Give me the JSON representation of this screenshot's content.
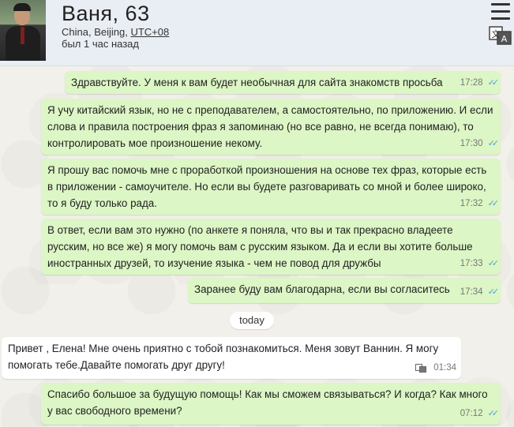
{
  "header": {
    "name": "Ваня, 63",
    "location_prefix": "China, Beijing, ",
    "timezone": "UTC+08",
    "last_seen": "был 1 час назад"
  },
  "icons": {
    "menu": "hamburger-menu-icon",
    "translate": "translate-icon",
    "message_translate": "translate-small-icon",
    "read_ticks": "double-check-icon"
  },
  "colors": {
    "outgoing_bubble": "#dcf6c5",
    "incoming_bubble": "#ffffff",
    "ticks": "#4fa3e0"
  },
  "date_separator": "today",
  "messages": [
    {
      "text": "Здравствуйте. У меня к вам будет необычная для сайта знакомств просьба",
      "time": "17:28",
      "direction": "out"
    },
    {
      "text": "Я учу китайский язык, но не с преподавателем, а самостоятельно, по приложению. И если слова и правила построения фраз я запоминаю (но все равно, не всегда понимаю), то контролировать мое произношение некому.",
      "time": "17:30",
      "direction": "out"
    },
    {
      "text": "Я прошу вас помочь мне с проработкой произношения на основе тех фраз, которые есть в приложении - самоучителе. Но если вы будете разговаривать со мной и более широко, то я буду только рада.",
      "time": "17:32",
      "direction": "out"
    },
    {
      "text": "В ответ, если вам это нужно (по анкете я поняла, что вы и так прекрасно владеете русским, но все же) я могу помочь вам с русским языком. Да и если вы хотите больше иностранных друзей, то изучение языка - чем не повод для дружбы",
      "time": "17:33",
      "direction": "out"
    },
    {
      "text": "Заранее буду вам благодарна, если вы согласитесь",
      "time": "17:34",
      "direction": "out"
    },
    {
      "text": "Привет , Елена! Мне очень приятно с тобой познакомиться. Меня зовут Ваннин. Я могу помогать тебе.Давайте помогать друг другу!",
      "time": "01:34",
      "direction": "in"
    },
    {
      "text": "Спасибо большое за будущую помощь! Как мы сможем связываться? И когда? Как много у вас свободного времени?",
      "time": "07:12",
      "direction": "out"
    }
  ]
}
